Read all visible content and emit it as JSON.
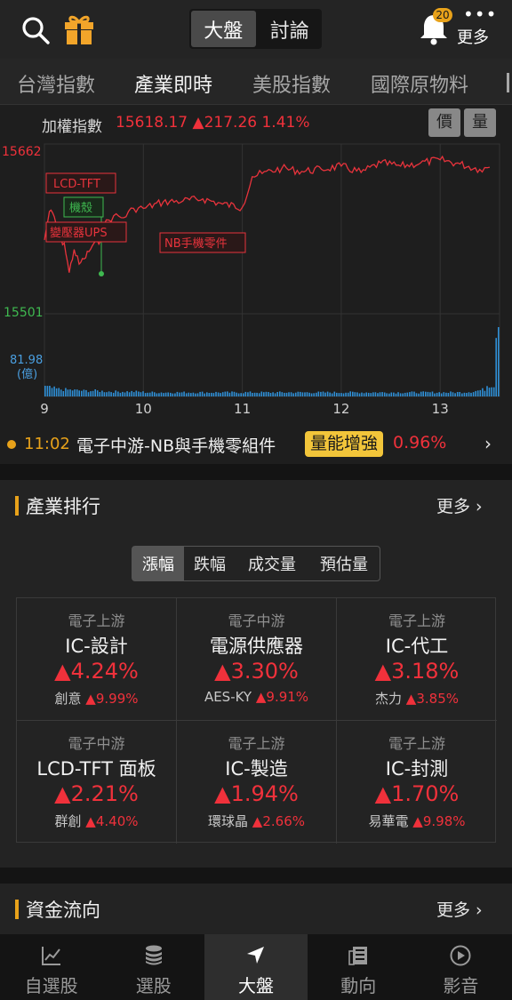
{
  "header": {
    "segments": [
      "大盤",
      "討論"
    ],
    "notification_count": "20",
    "more_label": "更多"
  },
  "tabs": [
    "台灣指數",
    "產業即時",
    "美股指數",
    "國際原物料"
  ],
  "index": {
    "name": "加權指數",
    "value": "15618.17 ▲217.26 1.41%",
    "price_button": "價",
    "volume_button": "量"
  },
  "chart_data": {
    "type": "line",
    "series": [
      {
        "name": "加權指數",
        "x": [
          9.0,
          9.05,
          9.1,
          9.15,
          9.2,
          9.25,
          9.3,
          9.35,
          9.4,
          9.45,
          9.5,
          9.55,
          9.6,
          9.7,
          9.8,
          9.9,
          10.0,
          10.2,
          10.4,
          10.6,
          10.8,
          11.0,
          11.1,
          11.2,
          11.4,
          11.6,
          11.8,
          12.0,
          12.2,
          12.4,
          12.6,
          12.8,
          13.0,
          13.2,
          13.4,
          13.5
        ],
        "values": [
          15571,
          15598,
          15593,
          15572,
          15568,
          15540,
          15562,
          15548,
          15553,
          15560,
          15568,
          15567,
          15585,
          15594,
          15592,
          15601,
          15601,
          15607,
          15608,
          15610,
          15605,
          15602,
          15631,
          15634,
          15639,
          15636,
          15638,
          15641,
          15635,
          15644,
          15641,
          15644,
          15647,
          15643,
          15638,
          15640
        ]
      }
    ],
    "volume": [
      12,
      9,
      8,
      7,
      7,
      6,
      6,
      6,
      5,
      5,
      5,
      5,
      5,
      5,
      5,
      5,
      5,
      5,
      5,
      5,
      5,
      5,
      5,
      5,
      5,
      5,
      5,
      5,
      5,
      5,
      5,
      5,
      5,
      6,
      9,
      82
    ],
    "y_max_label": "15662",
    "y_min_label": "15501",
    "ylim": [
      15501,
      15662
    ],
    "volume_label": "81.98",
    "volume_unit": "(億)",
    "x_ticks": [
      "9",
      "10",
      "11",
      "12",
      "13"
    ],
    "annotations": [
      "LCD-TFT",
      "機殼",
      "變壓器UPS",
      "NB手機零件"
    ]
  },
  "ticker": {
    "time": "11:02",
    "text": "電子中游-NB與手機零組件",
    "tag": "量能增強",
    "pct": "0.96%"
  },
  "ranking": {
    "title": "產業排行",
    "more": "更多 ›",
    "subtabs": [
      "漲幅",
      "跌幅",
      "成交量",
      "預估量"
    ],
    "items": [
      {
        "cat": "電子上游",
        "name": "IC-設計",
        "chg": "▲4.24%",
        "lead": "創意",
        "lead_pct": "▲9.99%"
      },
      {
        "cat": "電子中游",
        "name": "電源供應器",
        "chg": "▲3.30%",
        "lead": "AES-KY",
        "lead_pct": "▲9.91%"
      },
      {
        "cat": "電子上游",
        "name": "IC-代工",
        "chg": "▲3.18%",
        "lead": "杰力",
        "lead_pct": "▲3.85%"
      },
      {
        "cat": "電子中游",
        "name": "LCD-TFT 面板",
        "chg": "▲2.21%",
        "lead": "群創",
        "lead_pct": "▲4.40%"
      },
      {
        "cat": "電子上游",
        "name": "IC-製造",
        "chg": "▲1.94%",
        "lead": "環球晶",
        "lead_pct": "▲2.66%"
      },
      {
        "cat": "電子上游",
        "name": "IC-封測",
        "chg": "▲1.70%",
        "lead": "易華電",
        "lead_pct": "▲9.98%"
      }
    ]
  },
  "fund_flow": {
    "title": "資金流向",
    "more": "更多 ›"
  },
  "nav": [
    {
      "label": "自選股",
      "icon": "chart-line-icon"
    },
    {
      "label": "選股",
      "icon": "coin-stack-icon"
    },
    {
      "label": "大盤",
      "icon": "navigation-arrow-icon"
    },
    {
      "label": "動向",
      "icon": "newspaper-icon"
    },
    {
      "label": "影音",
      "icon": "play-circle-icon"
    }
  ],
  "colors": {
    "up": "#f0313b",
    "accent": "#e8a21a",
    "volume": "#2f8fd6"
  }
}
